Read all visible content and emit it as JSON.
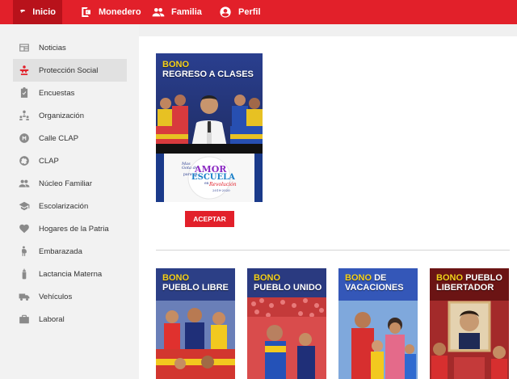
{
  "topbar": {
    "items": [
      {
        "label": "Inicio",
        "icon": "inicio-icon",
        "active": true
      },
      {
        "label": "Monedero",
        "icon": "wallet-icon"
      },
      {
        "label": "Familia",
        "icon": "family-icon"
      },
      {
        "label": "Perfil",
        "icon": "profile-icon"
      }
    ],
    "color": "#e2202a"
  },
  "sidebar": {
    "items": [
      {
        "label": "Noticias",
        "icon": "news-icon"
      },
      {
        "label": "Protección Social",
        "icon": "social-protection-icon",
        "active": true
      },
      {
        "label": "Encuestas",
        "icon": "survey-icon"
      },
      {
        "label": "Organización",
        "icon": "organization-icon"
      },
      {
        "label": "Calle CLAP",
        "icon": "calle-clap-icon"
      },
      {
        "label": "CLAP",
        "icon": "clap-icon"
      },
      {
        "label": "Núcleo Familiar",
        "icon": "family-nucleus-icon"
      },
      {
        "label": "Escolarización",
        "icon": "school-icon"
      },
      {
        "label": "Hogares de la Patria",
        "icon": "home-icon"
      },
      {
        "label": "Embarazada",
        "icon": "pregnant-icon"
      },
      {
        "label": "Lactancia Materna",
        "icon": "baby-bottle-icon"
      },
      {
        "label": "Vehículos",
        "icon": "vehicle-icon"
      },
      {
        "label": "Laboral",
        "icon": "briefcase-icon"
      }
    ]
  },
  "featured": {
    "bono": "BONO",
    "title": "REGRESO A CLASES",
    "logo_lines": [
      "Mas",
      "Gota de",
      "AMOR",
      "para mi",
      "ESCUELA",
      "en",
      "Revolución",
      "2019-2020"
    ],
    "button": "ACEPTAR"
  },
  "cards": [
    {
      "bono": "BONO",
      "title": "PUEBLO LIBRE"
    },
    {
      "bono": "BONO",
      "title": "PUEBLO UNIDO"
    },
    {
      "bono": "BONO",
      "title_line1": "DE",
      "title": "VACACIONES"
    },
    {
      "bono": "BONO",
      "title_line1": "PUEBLO",
      "title": "LIBERTADOR"
    }
  ]
}
